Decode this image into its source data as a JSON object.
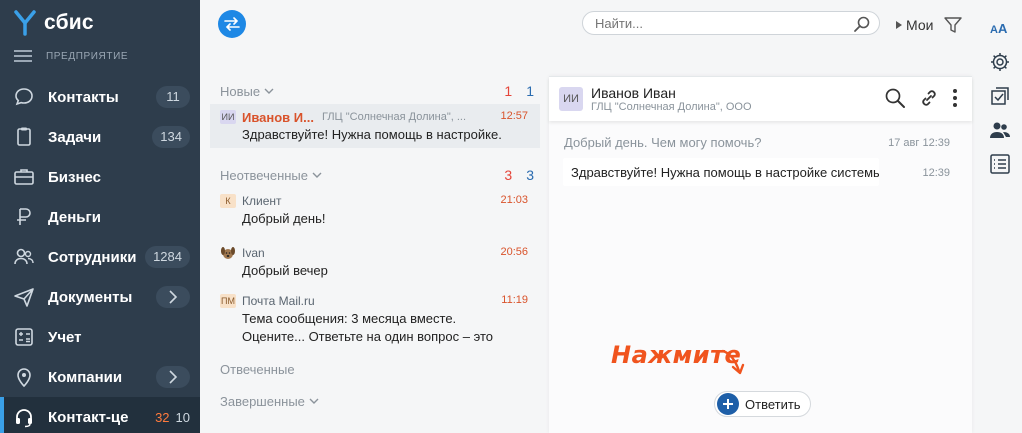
{
  "app": {
    "logo": "сбис",
    "org_label": "ПРЕДПРИЯТИЕ"
  },
  "nav": [
    {
      "label": "Контакты",
      "count": "11",
      "icon": "contacts-bubble-icon"
    },
    {
      "label": "Задачи",
      "count": "134",
      "icon": "tasks-icon"
    },
    {
      "label": "Бизнес",
      "count": "",
      "icon": "briefcase-icon"
    },
    {
      "label": "Деньги",
      "count": "",
      "icon": "money-icon"
    },
    {
      "label": "Сотрудники",
      "count": "1284",
      "icon": "employees-icon"
    },
    {
      "label": "Документы",
      "count": "",
      "icon": "paper-plane-icon"
    },
    {
      "label": "Учет",
      "count": "",
      "icon": "calculator-icon"
    },
    {
      "label": "Компании",
      "count": "",
      "icon": "map-pin-icon"
    },
    {
      "label": "Контакт-це",
      "count_red": "32",
      "count_gray": "10",
      "icon": "headset-icon"
    }
  ],
  "topbar": {
    "search_placeholder": "Найти...",
    "mine_label": "Мои"
  },
  "list": {
    "groups": {
      "new": {
        "title": "Новые",
        "count_red": "1",
        "count_blue": "1"
      },
      "unanswered": {
        "title": "Неотвеченные",
        "count_red": "3",
        "count_blue": "3"
      },
      "answered": {
        "title": "Отвеченные"
      },
      "finished": {
        "title": "Завершенные"
      }
    },
    "items": [
      {
        "avatar": "ИИ",
        "sender": "Иванов И...",
        "org": "ГЛЦ \"Солнечная Долина\", ...",
        "time": "12:57",
        "text": "Здравствуйте! Нужна помощь в настройке."
      },
      {
        "avatar": "К",
        "sender": "Клиент",
        "time": "21:03",
        "text": "Добрый день!"
      },
      {
        "avatar": "",
        "sender": "Ivan",
        "time": "20:56",
        "text": "Добрый вечер"
      },
      {
        "avatar": "ПМ",
        "sender": "Почта Mail.ru",
        "time": "11:19",
        "text": "Тема сообщения: 3 месяца вместе. Оцените... Ответьте на один вопрос – это не займёт м..."
      }
    ]
  },
  "chat": {
    "avatar": "ИИ",
    "name": "Иванов Иван",
    "org": "ГЛЦ \"Солнечная Долина\", ООО",
    "system_msg": "Добрый день. Чем могу помочь?",
    "system_time": "17 авг 12:39",
    "client_msg": "Здравствуйте! Нужна помощь в настройке системы",
    "client_time": "12:39",
    "hint": "Нажмите",
    "reply_label": "Ответить"
  },
  "colors": {
    "sidebar": "#2e3d4c",
    "accent": "#1e88e5",
    "orange": "#f0541e",
    "red": "#e5453a"
  }
}
